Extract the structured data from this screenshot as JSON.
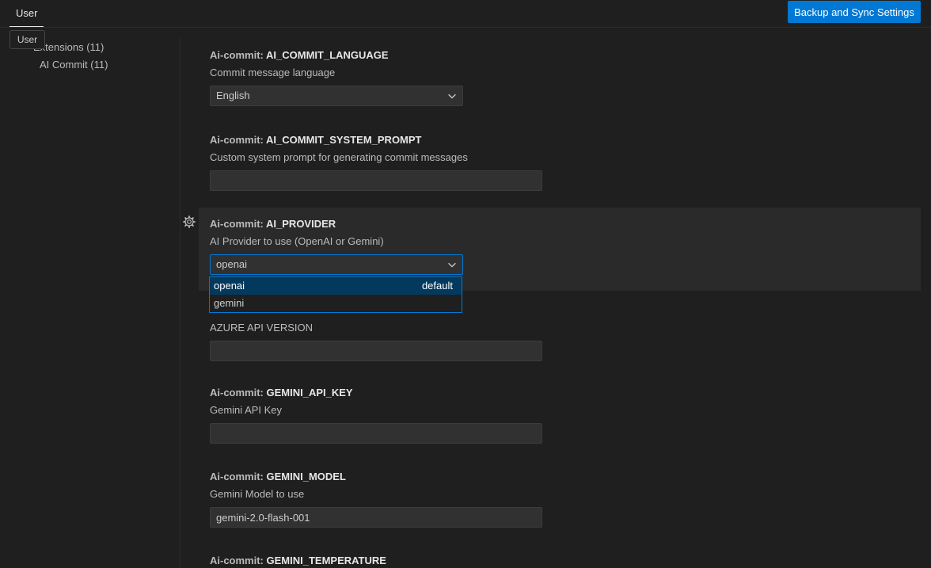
{
  "header": {
    "user_tab": "User",
    "sync_button": "Backup and Sync Settings",
    "tooltip": "User"
  },
  "sidebar": {
    "items": [
      {
        "label": "Extensions (11)"
      },
      {
        "label": "AI Commit (11)"
      }
    ]
  },
  "settings": [
    {
      "category": "Ai-commit: ",
      "key": "AI_COMMIT_LANGUAGE",
      "description": "Commit message language",
      "type": "select",
      "value": "English"
    },
    {
      "category": "Ai-commit: ",
      "key": "AI_COMMIT_SYSTEM_PROMPT",
      "description": "Custom system prompt for generating commit messages",
      "type": "text",
      "value": ""
    },
    {
      "category": "Ai-commit: ",
      "key": "AI_PROVIDER",
      "description": "AI Provider to use (OpenAI or Gemini)",
      "type": "select",
      "value": "openai"
    },
    {
      "category": "",
      "key": "",
      "description": "AZURE API VERSION",
      "type": "text",
      "value": ""
    },
    {
      "category": "Ai-commit: ",
      "key": "GEMINI_API_KEY",
      "description": "Gemini API Key",
      "type": "text",
      "value": ""
    },
    {
      "category": "Ai-commit: ",
      "key": "GEMINI_MODEL",
      "description": "Gemini Model to use",
      "type": "text",
      "value": "gemini-2.0-flash-001"
    },
    {
      "category": "Ai-commit: ",
      "key": "GEMINI_TEMPERATURE",
      "description": "",
      "type": "none",
      "value": ""
    }
  ],
  "dropdown": {
    "options": [
      {
        "label": "openai",
        "tag": "default"
      },
      {
        "label": "gemini",
        "tag": ""
      }
    ]
  },
  "icons": {
    "gear": "gear-icon",
    "chevron": "chevron-down-icon"
  },
  "colors": {
    "accent": "#0078d4",
    "background": "#1f1f1f",
    "selected_option": "#04395e"
  }
}
